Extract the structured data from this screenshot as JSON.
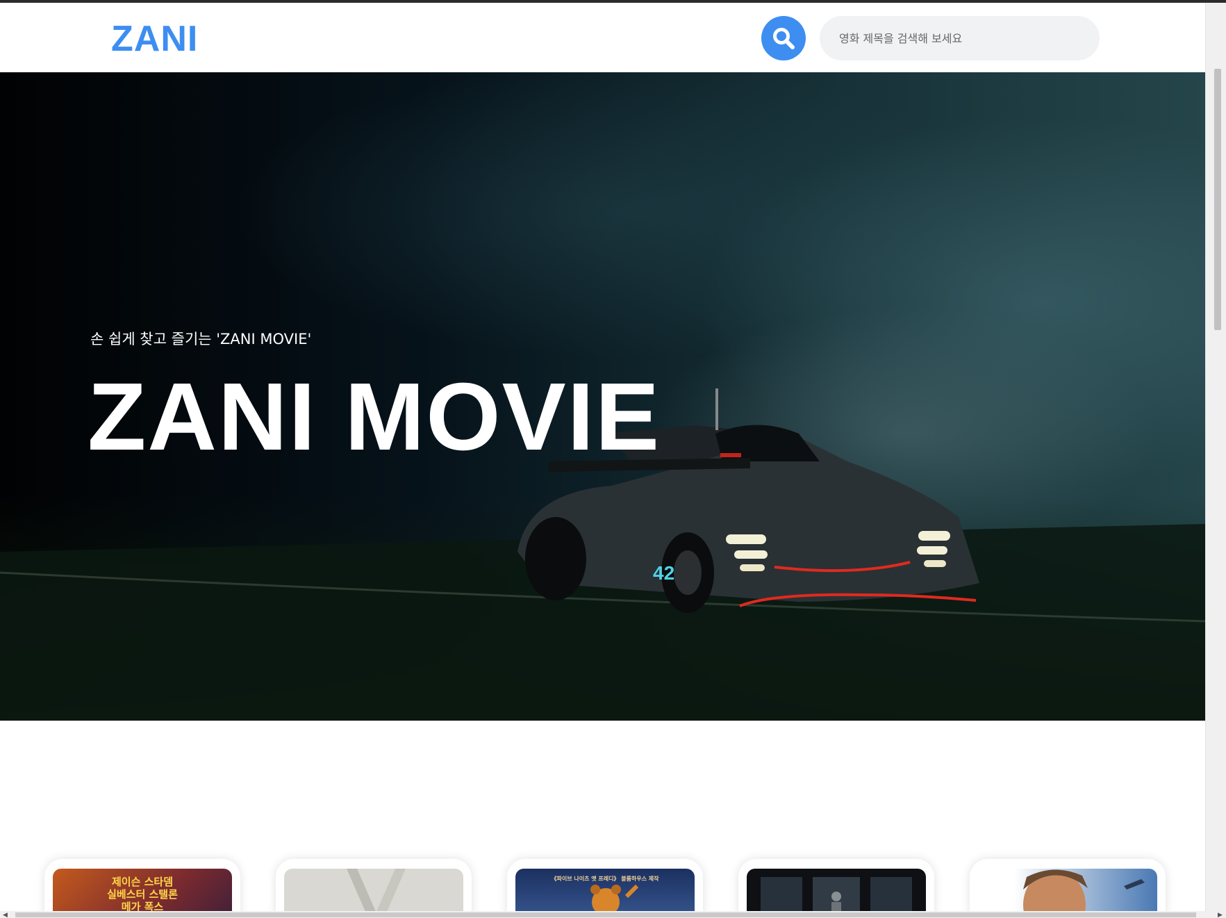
{
  "header": {
    "logo": "ZANI",
    "search_icon": "search-icon",
    "search_placeholder": "영화 제목을 검색해 보세요",
    "accent_color": "#3d8ef0"
  },
  "hero": {
    "subtitle": "손 쉽게 찾고 즐기는 'ZANI MOVIE'",
    "title": "ZANI MOVIE",
    "car_number": "42"
  },
  "movies": [
    {
      "poster_text": "제이슨 스타뎀\n실베스터 스탤론\n메가 폭스",
      "poster_color": "#9b3a20"
    },
    {
      "poster_text": "",
      "poster_color": "#d9d8d2"
    },
    {
      "poster_text": "《파이브 나이츠 앳 프레디》 블룸하우스 제작",
      "poster_color": "#23406e"
    },
    {
      "poster_text": "",
      "poster_color": "#1c2630"
    },
    {
      "poster_text": "",
      "poster_color": "#6f8fb8"
    }
  ]
}
